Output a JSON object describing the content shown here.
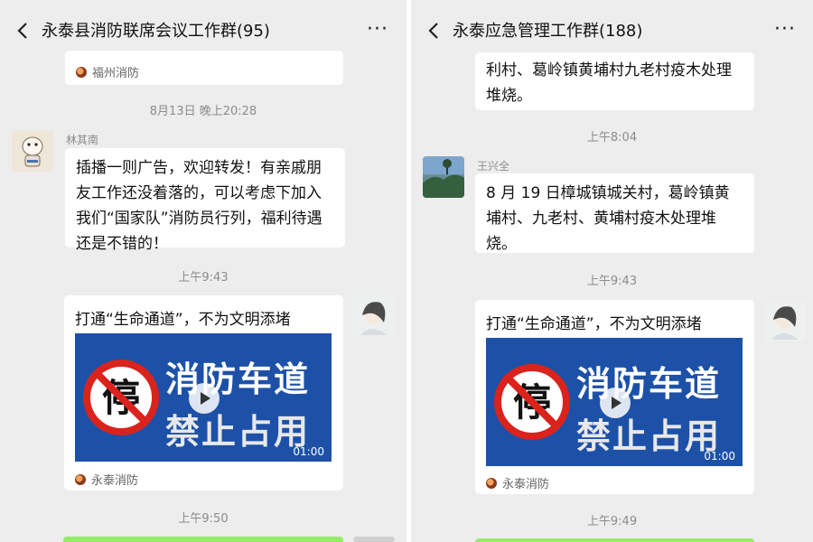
{
  "left": {
    "header": {
      "title": "永泰县消防联席会议工作群(95)",
      "more": "···"
    },
    "top_source": "福州消防",
    "time1": "8月13日 晚上20:28",
    "sender": "林其南",
    "message": "插播一则广告，欢迎转发！有亲戚朋友工作还没着落的，可以考虑下加入我们“国家队”消防员行列，福利待遇还是不错的！",
    "time2": "上午9:43",
    "video_card": {
      "title": "打通“生命通道”，不为文明添堵",
      "line1": "消防车道",
      "line2": "禁止占用",
      "duration": "01:00",
      "source": "永泰消防"
    },
    "time3": "上午9:50"
  },
  "right": {
    "header": {
      "title": "永泰应急管理工作群(188)",
      "more": "···"
    },
    "top_message": "利村、葛岭镇黄埔村九老村疫木处理堆烧。",
    "time1": "上午8:04",
    "sender": "王兴全",
    "message": "8 月 19 日樟城镇城关村，葛岭镇黄埔村、九老村、黄埔村疫木处理堆烧。",
    "time2": "上午9:43",
    "video_card": {
      "title": "打通“生命通道”，不为文明添堵",
      "line1": "消防车道",
      "line2": "禁止占用",
      "duration": "01:00",
      "source": "永泰消防"
    },
    "time3": "上午9:49"
  },
  "colors": {
    "chat_bg": "#ededed",
    "bubble": "#ffffff",
    "video_bg": "#1d51a8",
    "sent_bubble": "#95ec69",
    "no_sign": "#d9231c"
  }
}
